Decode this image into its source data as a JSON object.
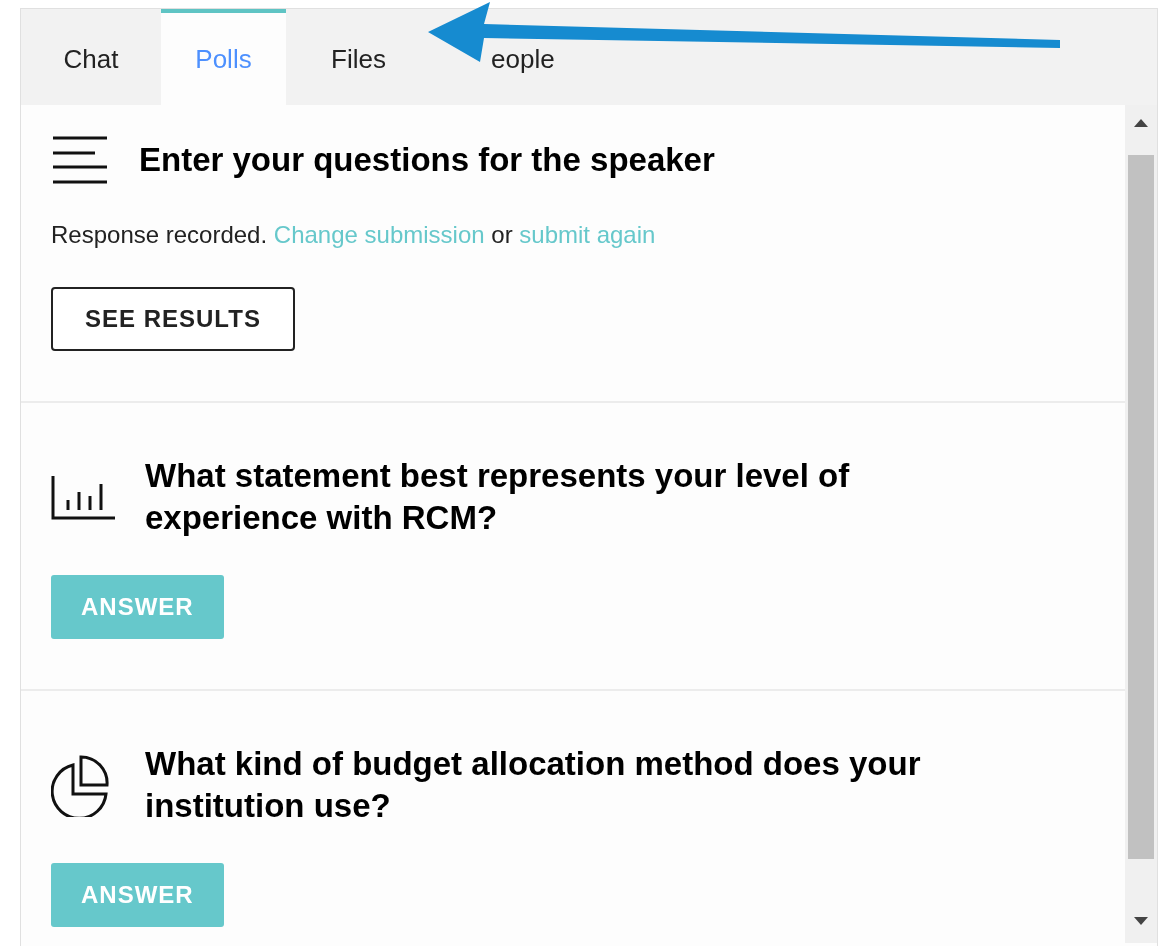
{
  "tabs": [
    {
      "label": "Chat",
      "selected": false
    },
    {
      "label": "Polls",
      "selected": true
    },
    {
      "label": "Files",
      "selected": false
    },
    {
      "label": "eople",
      "selected": false
    }
  ],
  "polls": [
    {
      "kind": "lines",
      "question": "Enter your questions for the speaker",
      "status": {
        "lead": "Response recorded.",
        "change_link": "Change submission",
        "joiner": "or",
        "again_link": "submit again"
      },
      "button": {
        "label": "SEE RESULTS",
        "kind": "outline"
      }
    },
    {
      "kind": "bars",
      "question": "What statement best represents your level of experience with RCM?",
      "button": {
        "label": "ANSWER",
        "kind": "filled"
      }
    },
    {
      "kind": "pie",
      "question": "What kind of budget allocation method does your institution use?",
      "button": {
        "label": "ANSWER",
        "kind": "filled"
      }
    }
  ]
}
